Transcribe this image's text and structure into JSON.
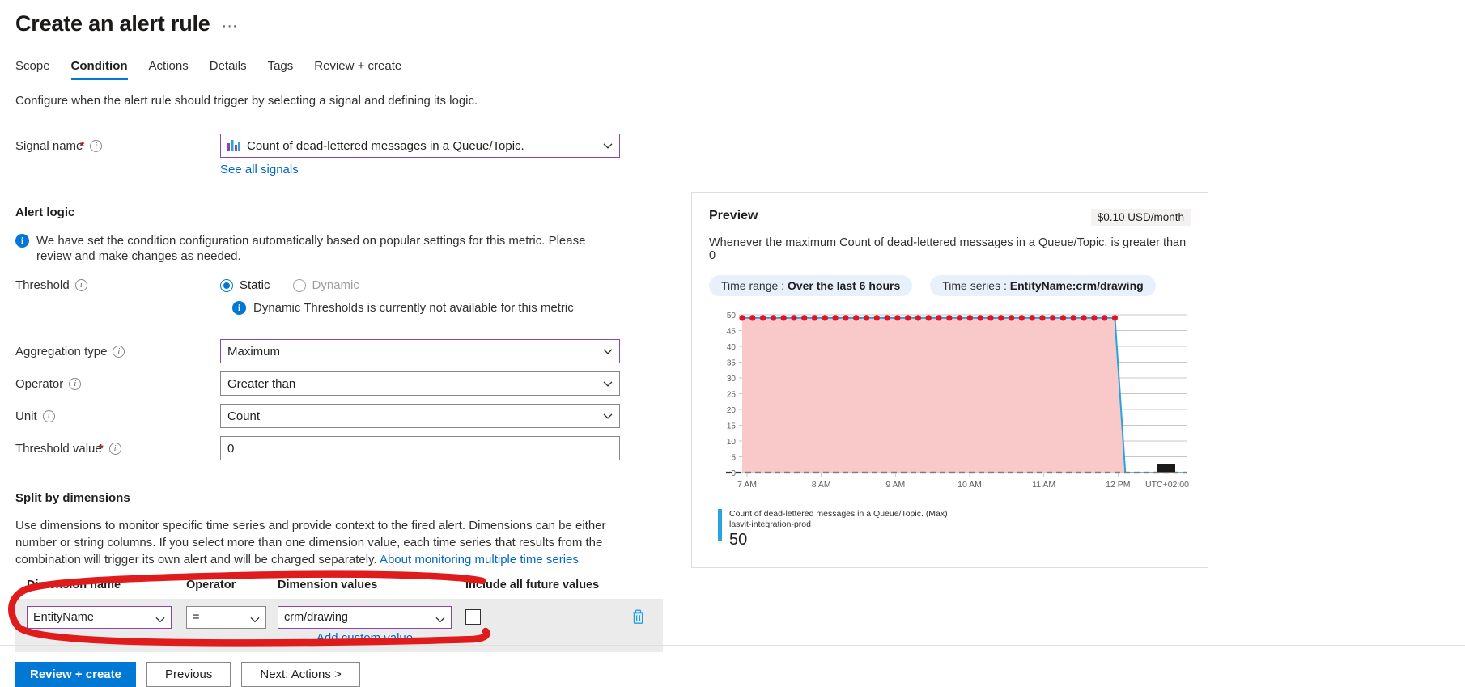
{
  "header": {
    "title": "Create an alert rule",
    "ellipsis": "···"
  },
  "tabs": [
    {
      "label": "Scope",
      "active": false
    },
    {
      "label": "Condition",
      "active": true
    },
    {
      "label": "Actions",
      "active": false
    },
    {
      "label": "Details",
      "active": false
    },
    {
      "label": "Tags",
      "active": false
    },
    {
      "label": "Review + create",
      "active": false
    }
  ],
  "tab_description": "Configure when the alert rule should trigger by selecting a signal and defining its logic.",
  "form": {
    "signal_name": {
      "label": "Signal name",
      "required": "*",
      "value": "Count of dead-lettered messages in a Queue/Topic.",
      "icon": "metric-chart-icon",
      "see_all_signals_link": "See all signals"
    },
    "alert_logic_heading": "Alert logic",
    "alert_logic_info": "We have set the condition configuration automatically based on popular settings for this metric. Please review and make changes as needed.",
    "threshold": {
      "label": "Threshold",
      "options": [
        {
          "label": "Static",
          "selected": true,
          "disabled": false
        },
        {
          "label": "Dynamic",
          "selected": false,
          "disabled": true
        }
      ],
      "note": "Dynamic Thresholds is currently not available for this metric"
    },
    "aggregation_type": {
      "label": "Aggregation type",
      "value": "Maximum"
    },
    "operator": {
      "label": "Operator",
      "value": "Greater than"
    },
    "unit": {
      "label": "Unit",
      "value": "Count"
    },
    "threshold_value": {
      "label": "Threshold value",
      "required": "*",
      "value": "0"
    }
  },
  "split_by_dimensions": {
    "heading": "Split by dimensions",
    "description": "Use dimensions to monitor specific time series and provide context to the fired alert. Dimensions can be either number or string columns. If you select more than one dimension value, each time series that results from the combination will trigger its own alert and will be charged separately.",
    "doc_link": "About monitoring multiple time series",
    "columns": [
      "Dimension name",
      "Operator",
      "Dimension values",
      "Include all future values"
    ],
    "rows": [
      {
        "dimension_name": "EntityName",
        "operator": "=",
        "dimension_values": "crm/drawing",
        "include_all_future_values": false,
        "add_custom_value_link": "Add custom value",
        "delete_icon": "trash-icon"
      }
    ]
  },
  "preview": {
    "title": "Preview",
    "cost": "$0.10 USD/month",
    "sentence": "Whenever the maximum Count of dead-lettered messages in a Queue/Topic. is greater than 0",
    "chips": [
      {
        "prefix": "Time range : ",
        "value": "Over the last 6 hours"
      },
      {
        "prefix": "Time series : ",
        "value": "EntityName:crm/drawing"
      }
    ],
    "legend": {
      "metric_title": "Count of dead-lettered messages in a Queue/Topic. (Max)",
      "resource": "lasvit-integration-prod",
      "value": "50",
      "color": "#27a3e0"
    }
  },
  "chart_data": {
    "type": "line",
    "title": "",
    "xlabel": "",
    "ylabel": "",
    "ylim": [
      0,
      50
    ],
    "yticks": [
      0,
      5,
      10,
      15,
      20,
      25,
      30,
      35,
      40,
      45,
      50
    ],
    "xticks": [
      "7 AM",
      "8 AM",
      "9 AM",
      "10 AM",
      "11 AM",
      "12 PM"
    ],
    "timezone_label": "UTC+02:00",
    "grid": true,
    "legend_position": "bottom-left",
    "threshold_line": {
      "value": 0,
      "style": "dashed",
      "color": "#333333"
    },
    "series": [
      {
        "name": "Count of dead-lettered messages in a Queue/Topic. (Max)",
        "color": "#27a3e0",
        "fill_color": "#f9c9c9",
        "marker_color": "#e81123",
        "x": [
          "7:00",
          "7:08",
          "7:16",
          "7:24",
          "7:32",
          "7:40",
          "7:48",
          "7:56",
          "8:04",
          "8:12",
          "8:20",
          "8:28",
          "8:36",
          "8:44",
          "8:52",
          "9:00",
          "9:08",
          "9:16",
          "9:24",
          "9:32",
          "9:40",
          "9:48",
          "9:56",
          "10:04",
          "10:12",
          "10:20",
          "10:28",
          "10:36",
          "10:44",
          "10:52",
          "11:00",
          "11:08",
          "11:16",
          "11:24",
          "11:32",
          "11:40",
          "11:44",
          "11:48",
          "11:52",
          "12:00",
          "12:08",
          "12:16",
          "12:24",
          "12:32"
        ],
        "values": [
          49,
          49,
          49,
          49,
          49,
          49,
          49,
          49,
          49,
          49,
          49,
          49,
          49,
          49,
          49,
          49,
          49,
          49,
          49,
          49,
          49,
          49,
          49,
          49,
          49,
          49,
          49,
          49,
          49,
          49,
          49,
          49,
          49,
          49,
          49,
          49,
          49,
          0,
          0,
          0,
          0,
          0,
          0,
          0
        ]
      }
    ]
  },
  "footer": {
    "review_create": "Review + create",
    "previous": "Previous",
    "next": "Next: Actions >"
  },
  "colors": {
    "accent": "#0078d4",
    "focus_border": "#8e44ad",
    "link": "#0066cc",
    "annotation": "#e01b1b",
    "series": "#27a3e0",
    "marker": "#e81123"
  }
}
